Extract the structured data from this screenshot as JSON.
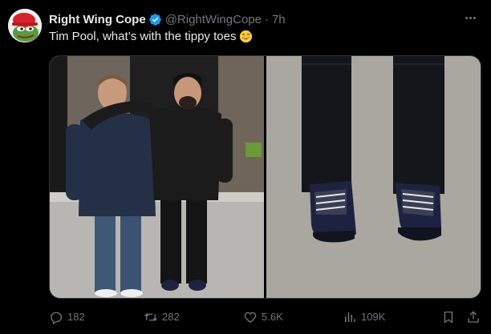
{
  "post": {
    "display_name": "Right Wing Cope",
    "handle": "@RightWingCope",
    "separator": "·",
    "time": "7h",
    "text": "Tim Pool, what’s with the tippy toes",
    "emoji": "grinning-sweat-emoji",
    "avatar_icon": "pepe-maga-hat-avatar",
    "verified_icon": "verified-badge-icon"
  },
  "media": {
    "photos": [
      {
        "kind": "two-men-standing-photo"
      },
      {
        "kind": "shoes-closeup-photo"
      }
    ]
  },
  "actions": {
    "replies": "182",
    "reposts": "282",
    "likes": "5.6K",
    "views": "109K"
  },
  "colors": {
    "background": "#000000",
    "text_primary": "#e7e9ea",
    "text_secondary": "#71767b",
    "verified_blue": "#1d9bf0",
    "border": "#2f3336"
  }
}
